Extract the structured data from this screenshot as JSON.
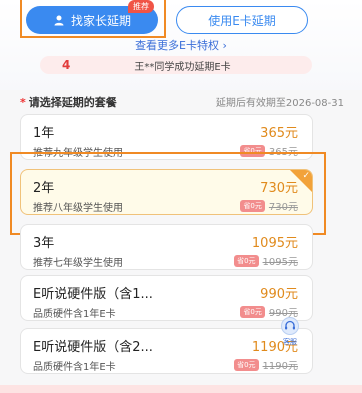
{
  "tabs": {
    "parent_extend": {
      "label": "找家长延期",
      "badge": "推荐"
    },
    "ecard_extend": {
      "label": "使用E卡延期"
    }
  },
  "links": {
    "more_privileges": "查看更多E卡特权 ›"
  },
  "notice": {
    "count": "4",
    "text": "王**同学成功延期E卡"
  },
  "packages": {
    "section_label": "请选择延期的套餐",
    "required_mark": "*",
    "expiry_text": "延期后有效期至2026-08-31",
    "items": [
      {
        "title": "1年",
        "subtitle": "推荐九年级学生使用",
        "price": "365元",
        "save_badge": "省0元",
        "original_price": "365元"
      },
      {
        "title": "2年",
        "subtitle": "推荐八年级学生使用",
        "price": "730元",
        "save_badge": "省0元",
        "original_price": "730元"
      },
      {
        "title": "3年",
        "subtitle": "推荐七年级学生使用",
        "price": "1095元",
        "save_badge": "省0元",
        "original_price": "1095元"
      },
      {
        "title": "E听说硬件版（含1...",
        "subtitle": "品质硬件含1年E卡",
        "price": "990元",
        "save_badge": "省0元",
        "original_price": "990元"
      },
      {
        "title": "E听说硬件版（含2...",
        "subtitle": "品质硬件含1年E卡",
        "price": "1190元",
        "save_badge": "省0元",
        "original_price": "1190元"
      }
    ],
    "selected_index": 1
  },
  "service": {
    "label": "客服",
    "icon": "headset-icon"
  },
  "colors": {
    "accent": "#3a8af0",
    "price": "#e08a1c",
    "highlight": "#f08a24",
    "badge": "#f05446"
  }
}
